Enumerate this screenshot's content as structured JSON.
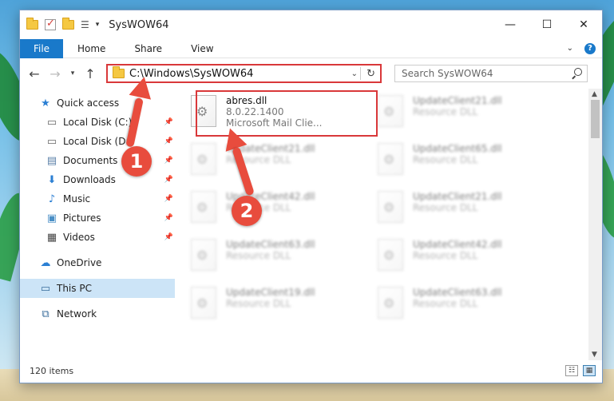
{
  "window": {
    "title": "SysWOW64",
    "controls": {
      "minimize": "—",
      "maximize": "☐",
      "close": "✕"
    }
  },
  "ribbon": {
    "tabs": [
      "File",
      "Home",
      "Share",
      "View"
    ]
  },
  "navigation": {
    "address": "C:\\Windows\\SysWOW64",
    "search_placeholder": "Search SysWOW64"
  },
  "sidebar": {
    "items": [
      {
        "label": "Quick access",
        "icon": "star-icon",
        "pinned": false,
        "level": 0
      },
      {
        "label": "Local Disk (C:)",
        "icon": "drive-icon",
        "pinned": true,
        "level": 1
      },
      {
        "label": "Local Disk (D:)",
        "icon": "drive-icon",
        "pinned": true,
        "level": 1
      },
      {
        "label": "Documents",
        "icon": "documents-icon",
        "pinned": true,
        "level": 1
      },
      {
        "label": "Downloads",
        "icon": "downloads-icon",
        "pinned": true,
        "level": 1
      },
      {
        "label": "Music",
        "icon": "music-icon",
        "pinned": true,
        "level": 1
      },
      {
        "label": "Pictures",
        "icon": "pictures-icon",
        "pinned": true,
        "level": 1
      },
      {
        "label": "Videos",
        "icon": "videos-icon",
        "pinned": true,
        "level": 1
      },
      {
        "label": "OneDrive",
        "icon": "cloud-icon",
        "pinned": false,
        "level": 0
      },
      {
        "label": "This PC",
        "icon": "computer-icon",
        "pinned": false,
        "level": 0,
        "selected": true
      },
      {
        "label": "Network",
        "icon": "network-icon",
        "pinned": false,
        "level": 0
      }
    ]
  },
  "files": [
    {
      "name": "abres.dll",
      "line2": "8.0.22.1400",
      "line3": "Microsoft Mail Clie...",
      "blurred": false
    },
    {
      "name": "UpdateClient21.dll",
      "line2": "Resource DLL",
      "blurred": true
    },
    {
      "name": "UpdateClient21.dll",
      "line2": "Resource DLL",
      "blurred": true
    },
    {
      "name": "UpdateClient65.dll",
      "line2": "Resource DLL",
      "blurred": true
    },
    {
      "name": "UpdateClient42.dll",
      "line2": "Resource DLL",
      "blurred": true
    },
    {
      "name": "UpdateClient21.dll",
      "line2": "Resource DLL",
      "blurred": true
    },
    {
      "name": "UpdateClient63.dll",
      "line2": "Resource DLL",
      "blurred": true
    },
    {
      "name": "UpdateClient42.dll",
      "line2": "Resource DLL",
      "blurred": true
    },
    {
      "name": "UpdateClient19.dll",
      "line2": "Resource DLL",
      "blurred": true
    },
    {
      "name": "UpdateClient63.dll",
      "line2": "Resource DLL",
      "blurred": true
    }
  ],
  "status": {
    "item_count": "120 items"
  },
  "annotations": {
    "step1": "1",
    "step2": "2",
    "color": "#e84c3d"
  }
}
